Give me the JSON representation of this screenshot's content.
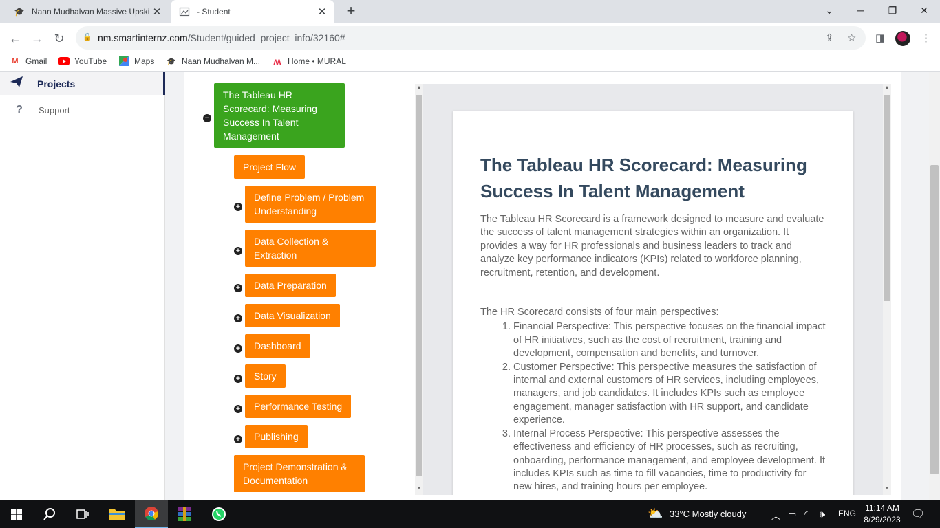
{
  "browser": {
    "tabs": [
      {
        "title": "Naan Mudhalvan Massive Upskill",
        "favicon": "graduation-cap-icon"
      },
      {
        "title": "- Student",
        "favicon": "image-icon"
      }
    ],
    "url_host": "nm.smartinternz.com",
    "url_path": "/Student/guided_project_info/32160#",
    "bookmarks": [
      {
        "label": "Gmail",
        "icon": "gmail-icon"
      },
      {
        "label": "YouTube",
        "icon": "youtube-icon"
      },
      {
        "label": "Maps",
        "icon": "maps-icon"
      },
      {
        "label": "Naan Mudhalvan M...",
        "icon": "graduation-cap-icon"
      },
      {
        "label": "Home • MURAL",
        "icon": "mural-icon"
      }
    ]
  },
  "sidebar": {
    "items": [
      {
        "label": "Projects",
        "icon": "paper-plane-icon",
        "active": true
      },
      {
        "label": "Support",
        "icon": "question-icon",
        "active": false
      }
    ]
  },
  "flow": {
    "root": "The Tableau HR Scorecard: Measuring Success In Talent Management",
    "project_flow": "Project Flow",
    "steps": [
      "Define Problem / Problem Understanding",
      "Data Collection & Extraction",
      "Data Preparation",
      "Data Visualization",
      "Dashboard",
      "Story",
      "Performance Testing",
      "Publishing"
    ],
    "final": "Project Demonstration & Documentation",
    "colors": {
      "root": "#3aa41e",
      "step": "#ff8000"
    }
  },
  "content": {
    "title": "The Tableau HR Scorecard: Measuring Success In Talent Management",
    "intro": "The Tableau HR Scorecard is a framework designed to measure and evaluate the success of talent management strategies within an organization. It provides a way for HR professionals and business leaders to track and analyze key performance indicators (KPIs) related to workforce planning, recruitment, retention, and development.",
    "intro2": "The HR Scorecard consists of four main perspectives:",
    "perspectives": [
      "Financial Perspective: This perspective focuses on the financial impact of HR initiatives, such as the cost of recruitment, training and development, compensation and benefits, and turnover.",
      "Customer Perspective: This perspective measures the satisfaction of internal and external customers of HR services, including employees, managers, and job candidates. It includes KPIs such as employee engagement, manager satisfaction with HR support, and candidate experience.",
      "Internal Process Perspective: This perspective assesses the effectiveness and efficiency of HR processes, such as recruiting, onboarding, performance management, and employee development. It includes KPIs such as time to fill vacancies, time to productivity for new hires, and training hours per employee."
    ]
  },
  "taskbar": {
    "weather": "33°C  Mostly cloudy",
    "lang": "ENG",
    "time": "11:14 AM",
    "date": "8/29/2023"
  }
}
